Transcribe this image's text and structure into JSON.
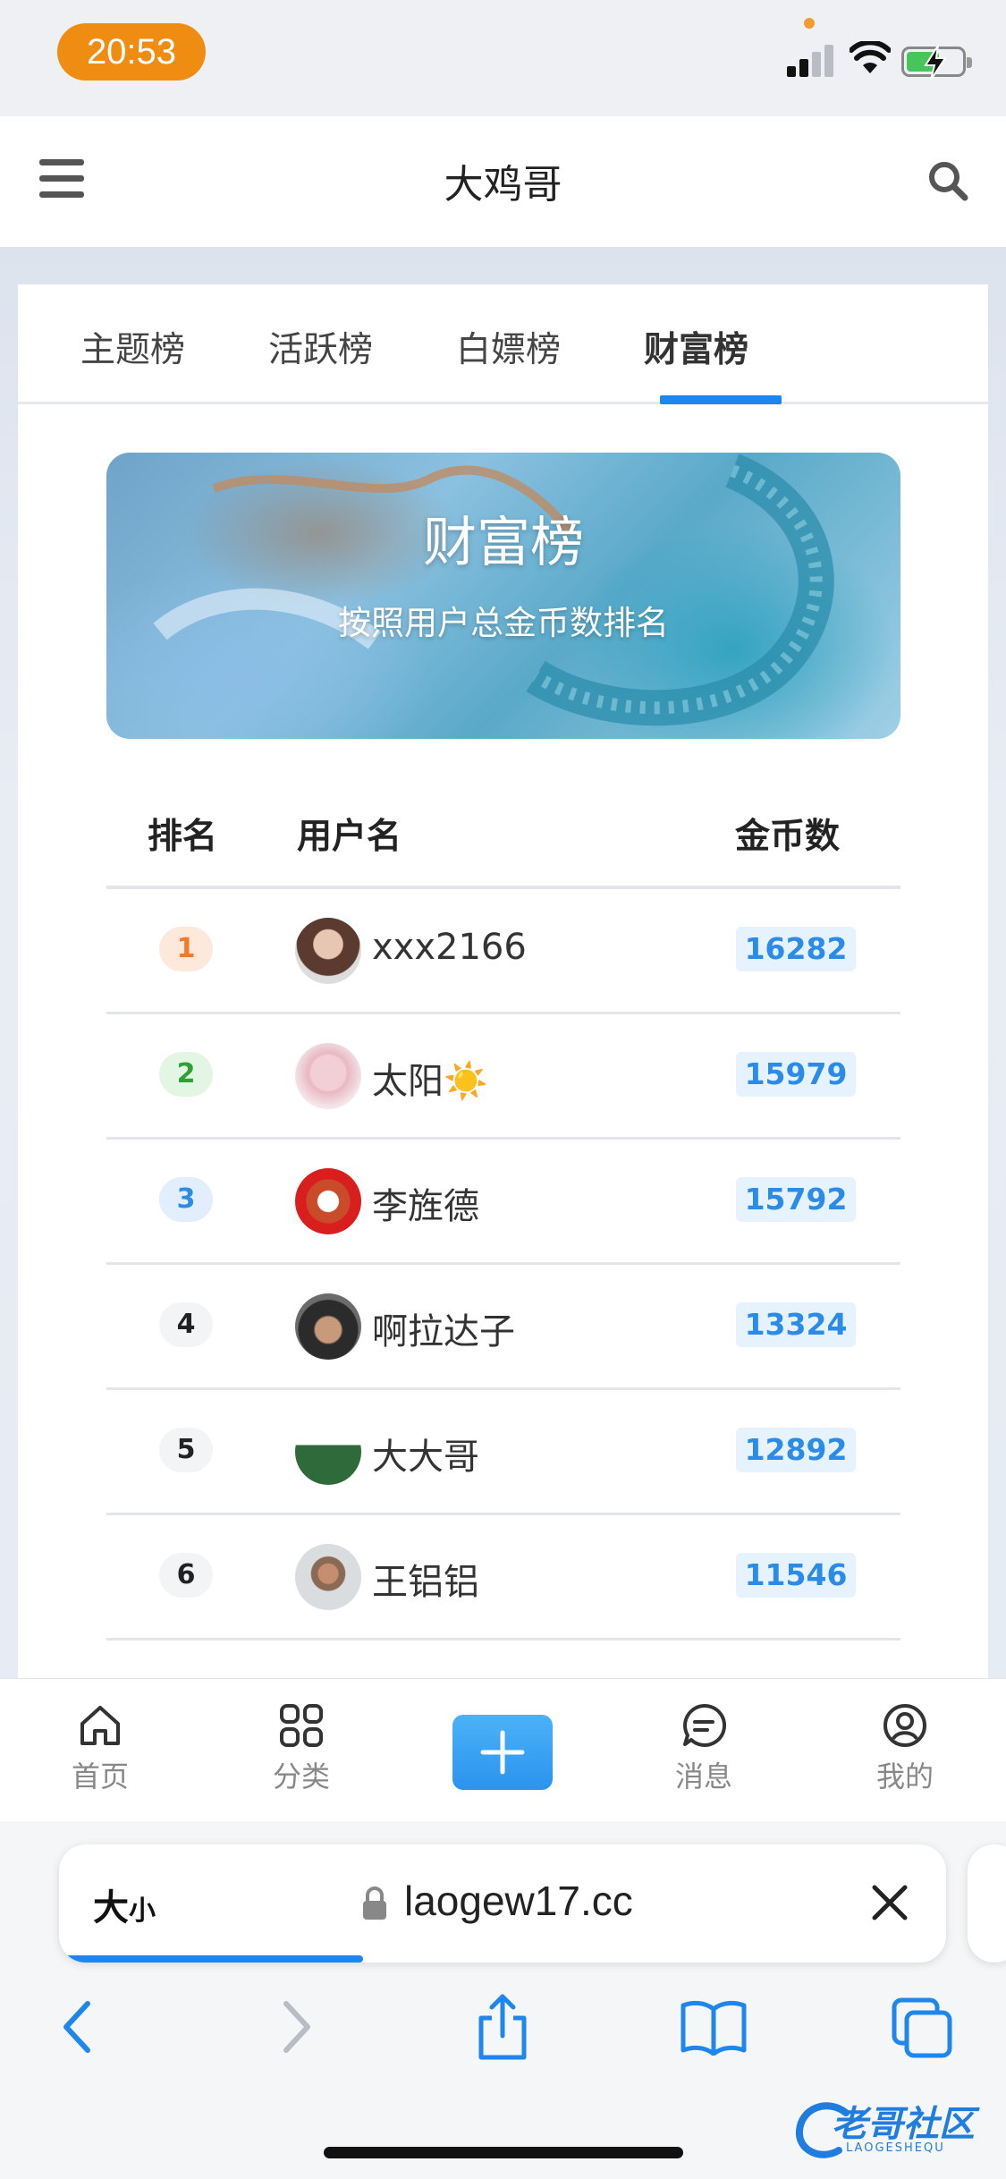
{
  "status_bar": {
    "time": "20:53"
  },
  "header": {
    "title": "大鸡哥"
  },
  "tabs": [
    {
      "label": "主题榜",
      "active": false
    },
    {
      "label": "活跃榜",
      "active": false
    },
    {
      "label": "白嫖榜",
      "active": false
    },
    {
      "label": "财富榜",
      "active": true
    }
  ],
  "banner": {
    "title": "财富榜",
    "subtitle": "按照用户总金币数排名"
  },
  "table": {
    "headers": {
      "rank": "排名",
      "username": "用户名",
      "coins": "金币数"
    },
    "rows": [
      {
        "rank": "1",
        "username": "xxx2166",
        "coins": "16282"
      },
      {
        "rank": "2",
        "username": "太阳☀️",
        "coins": "15979"
      },
      {
        "rank": "3",
        "username": "李旌德",
        "coins": "15792"
      },
      {
        "rank": "4",
        "username": "啊拉达子",
        "coins": "13324"
      },
      {
        "rank": "5",
        "username": "大大哥",
        "coins": "12892"
      },
      {
        "rank": "6",
        "username": "王铝铝",
        "coins": "11546"
      }
    ]
  },
  "bottom_nav": {
    "home": "首页",
    "category": "分类",
    "messages": "消息",
    "mine": "我的"
  },
  "browser": {
    "text_size": "大",
    "text_size_small": "小",
    "url": "laogew17.cc"
  },
  "watermark": {
    "text": "老哥社区",
    "sub": "LAOGESHEQU"
  },
  "colors": {
    "accent": "#1f86ee",
    "time_pill": "#ef8c12",
    "coin_text": "#2a8be8"
  }
}
